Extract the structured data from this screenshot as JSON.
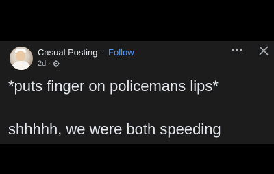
{
  "post": {
    "author": "Casual Posting",
    "separator": "·",
    "follow_label": "Follow",
    "age": "2d",
    "age_separator": "·",
    "privacy_icon": "gear-icon",
    "more_icon": "more-icon",
    "close_icon": "close-icon",
    "text_lines": [
      "*puts finger on policemans lips*",
      "shhhhh, we were both speeding"
    ]
  },
  "colors": {
    "background": "#000000",
    "card": "#1c1c1d",
    "text": "#e4e6eb",
    "muted": "#b0b3b8",
    "link": "#4c97ff"
  }
}
